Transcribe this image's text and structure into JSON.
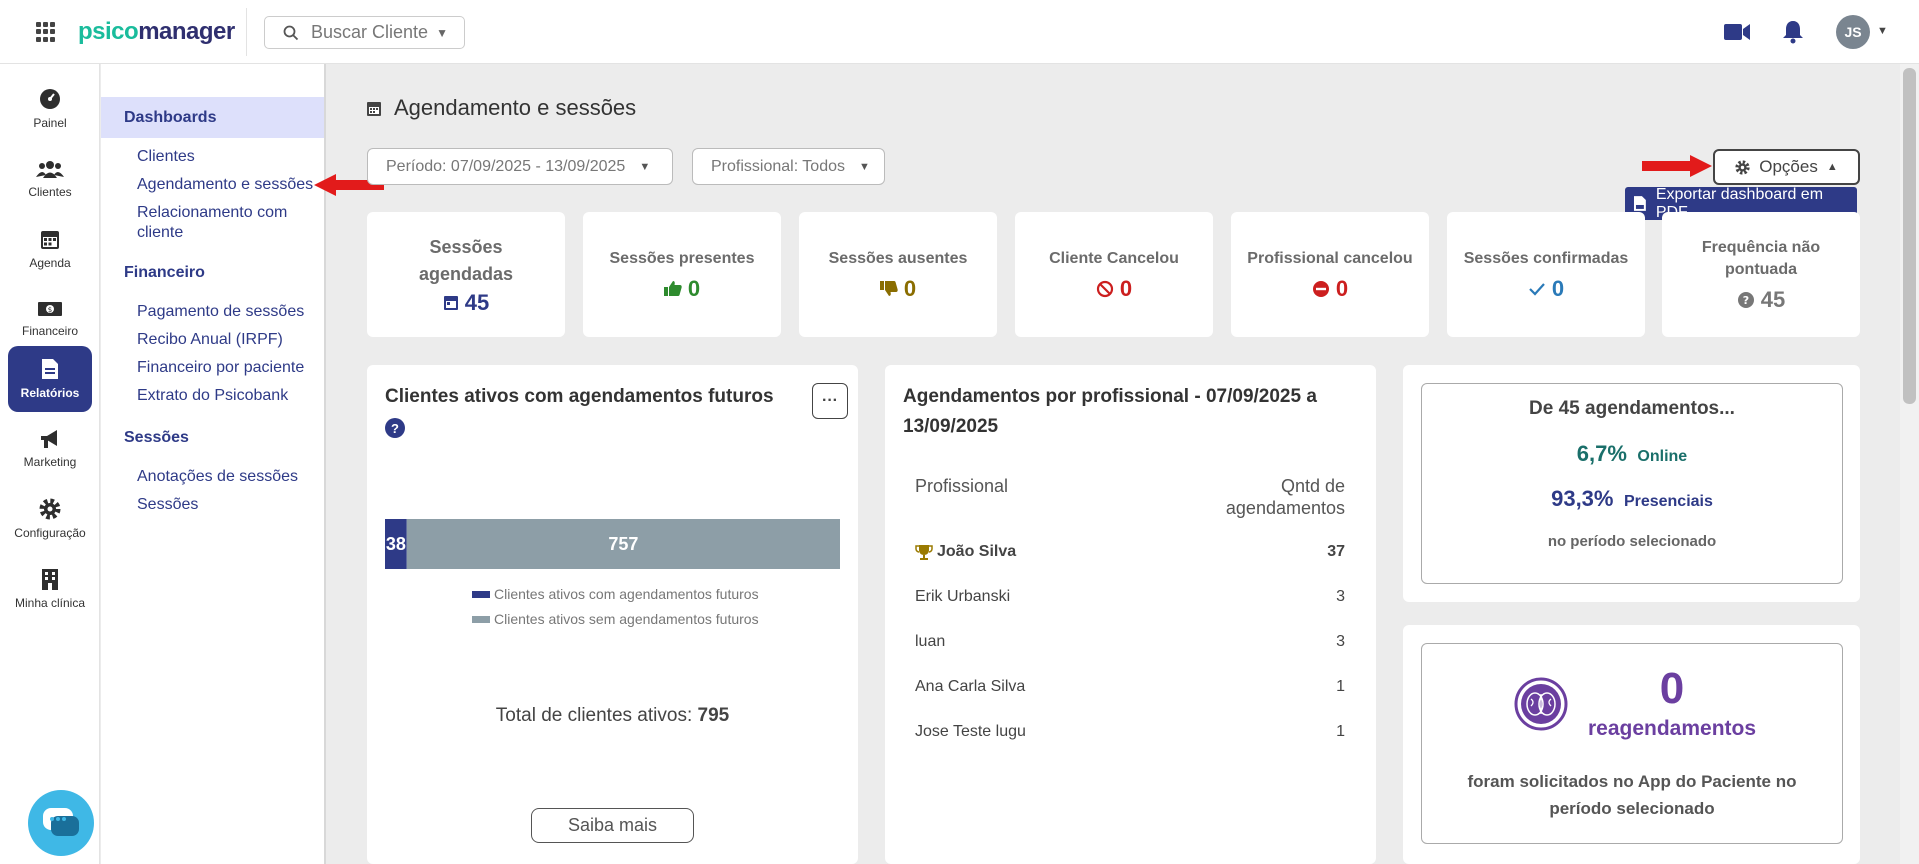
{
  "app": {
    "logo_left": "psico",
    "logo_right": "manager"
  },
  "search": {
    "label": "Buscar Cliente"
  },
  "user": {
    "initials": "JS"
  },
  "rail": {
    "items": [
      {
        "label": "Painel"
      },
      {
        "label": "Clientes"
      },
      {
        "label": "Agenda"
      },
      {
        "label": "Financeiro"
      },
      {
        "label": "Relatórios"
      },
      {
        "label": "Marketing"
      },
      {
        "label": "Configuração"
      },
      {
        "label": "Minha clínica"
      }
    ]
  },
  "submenu": {
    "active": "Dashboards",
    "dashboards": [
      "Clientes",
      "Agendamento e sessões",
      "Relacionamento com cliente"
    ],
    "financeiro_head": "Financeiro",
    "financeiro": [
      "Pagamento de sessões",
      "Recibo Anual (IRPF)",
      "Financeiro por paciente",
      "Extrato do Psicobank"
    ],
    "sessoes_head": "Sessões",
    "sessoes": [
      "Anotações de sessões",
      "Sessões"
    ]
  },
  "page": {
    "title": "Agendamento e sessões"
  },
  "filters": {
    "periodo": "Período: 07/09/2025 - 13/09/2025",
    "profissional": "Profissional: Todos"
  },
  "options": {
    "label": "Opções",
    "export_label": "Exportar dashboard em PDF"
  },
  "stats": [
    {
      "label": "Sessões agendadas",
      "value": "45",
      "color": "#2e3a87"
    },
    {
      "label": "Sessões presentes",
      "value": "0",
      "color": "#2e8b2e"
    },
    {
      "label": "Sessões ausentes",
      "value": "0",
      "color": "#8a6d00"
    },
    {
      "label": "Cliente Cancelou",
      "value": "0",
      "color": "#cc1f1f"
    },
    {
      "label": "Profissional cancelou",
      "value": "0",
      "color": "#cc1f1f"
    },
    {
      "label": "Sessões confirmadas",
      "value": "0",
      "color": "#2a7ab8"
    },
    {
      "label": "Frequência não pontuada",
      "value": "45",
      "color": "#777777"
    }
  ],
  "clientes_panel": {
    "title": "Clientes ativos com agendamentos futuros",
    "help": "?",
    "more": "···",
    "legend": [
      "Clientes ativos com agendamentos futuros",
      "Clientes ativos sem agendamentos futuros"
    ],
    "total_label": "Total de clientes ativos:",
    "total_value": "795",
    "cta": "Saiba mais"
  },
  "chart_data": {
    "type": "bar",
    "orientation": "horizontal-stacked",
    "categories": [
      ""
    ],
    "series": [
      {
        "name": "Clientes ativos com agendamentos futuros",
        "values": [
          38
        ],
        "color": "#2e3a87"
      },
      {
        "name": "Clientes ativos sem agendamentos futuros",
        "values": [
          757
        ],
        "color": "#8d9ea7"
      }
    ],
    "title": "",
    "xlabel": "",
    "ylabel": ""
  },
  "prof_panel": {
    "title": "Agendamentos por profissional - 07/09/2025 a 13/09/2025",
    "col_prof": "Profissional",
    "col_qtd": "Qntd de agendamentos",
    "rows": [
      {
        "name": "João Silva",
        "qtd": "37"
      },
      {
        "name": "Erik Urbanski",
        "qtd": "3"
      },
      {
        "name": "luan",
        "qtd": "3"
      },
      {
        "name": "Ana Carla Silva",
        "qtd": "1"
      },
      {
        "name": "Jose Teste lugu",
        "qtd": "1"
      }
    ]
  },
  "summary_panel": {
    "title": "De 45 agendamentos...",
    "online_pct": "6,7%",
    "online_label": "Online",
    "pres_pct": "93,3%",
    "pres_label": "Presenciais",
    "footer": "no período selecionado"
  },
  "reag_panel": {
    "count": "0",
    "label": "reagendamentos",
    "desc": "foram solicitados no App do Paciente no período selecionado"
  }
}
